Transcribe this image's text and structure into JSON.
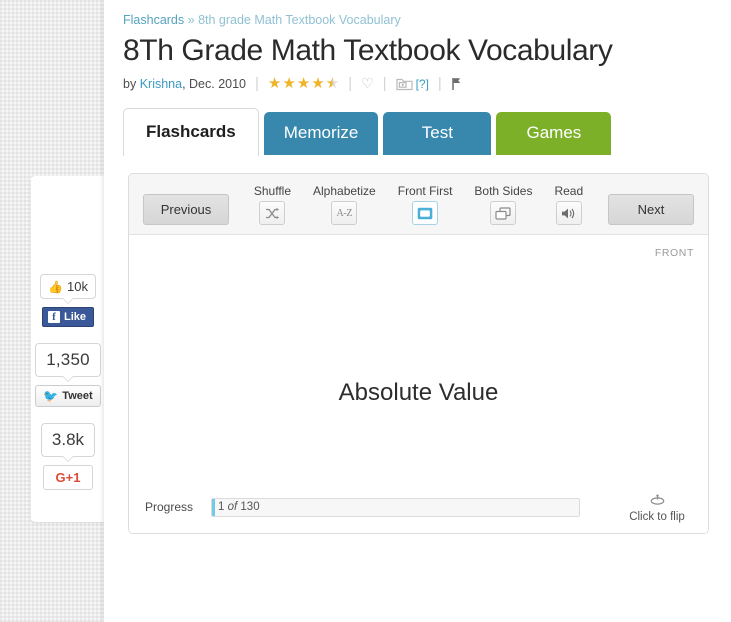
{
  "breadcrumb": {
    "root": "Flashcards",
    "separator": "»",
    "current": "8th grade Math Textbook Vocabulary"
  },
  "header": {
    "title": "8Th Grade Math Textbook Vocabulary",
    "by_label": "by",
    "author": "Krishna",
    "date": ", Dec. 2010",
    "rating_value": 4.5,
    "rating_max": 5,
    "favorite_icon": "heart-icon",
    "add_to_folder_icon": "folder-add-icon",
    "help_link": "[?]",
    "flag_icon": "flag-icon"
  },
  "tabs": [
    {
      "label": "Flashcards",
      "active": true,
      "color": "#ffffff"
    },
    {
      "label": "Memorize",
      "active": false,
      "color": "#3888ae"
    },
    {
      "label": "Test",
      "active": false,
      "color": "#3888ae"
    },
    {
      "label": "Games",
      "active": false,
      "color": "#7cb029"
    }
  ],
  "toolbar": {
    "previous_label": "Previous",
    "next_label": "Next",
    "tools": [
      {
        "label": "Shuffle",
        "icon": "shuffle-icon",
        "glyph": "⤨",
        "active": false
      },
      {
        "label": "Alphabetize",
        "icon": "a-to-z-icon",
        "glyph": "A-Z",
        "active": false
      },
      {
        "label": "Front First",
        "icon": "front-first-icon",
        "glyph": "▣",
        "active": true
      },
      {
        "label": "Both Sides",
        "icon": "both-sides-icon",
        "glyph": "⧉",
        "active": false
      },
      {
        "label": "Read",
        "icon": "speaker-icon",
        "glyph": "🔊",
        "active": false
      }
    ]
  },
  "card": {
    "side_label": "FRONT",
    "term": "Absolute Value",
    "flip_icon": "flip-rotate-icon",
    "flip_label": "Click to flip"
  },
  "progress": {
    "label": "Progress",
    "current": "1",
    "of_label": "of",
    "total": "130",
    "percent": 0.77,
    "fill_color": "#6fcbe8"
  },
  "social": {
    "facebook": {
      "count": "10k",
      "button_label": "Like",
      "icon": "facebook-icon",
      "thumb_icon": "thumbs-up-icon",
      "color": "#3b5998"
    },
    "twitter": {
      "count": "1,350",
      "button_label": "Tweet",
      "icon": "twitter-bird-icon",
      "color": "#1da1f2"
    },
    "google": {
      "count": "3.8k",
      "button_label": "G+1",
      "icon": "google-plus-icon",
      "color": "#dd4b39"
    }
  }
}
